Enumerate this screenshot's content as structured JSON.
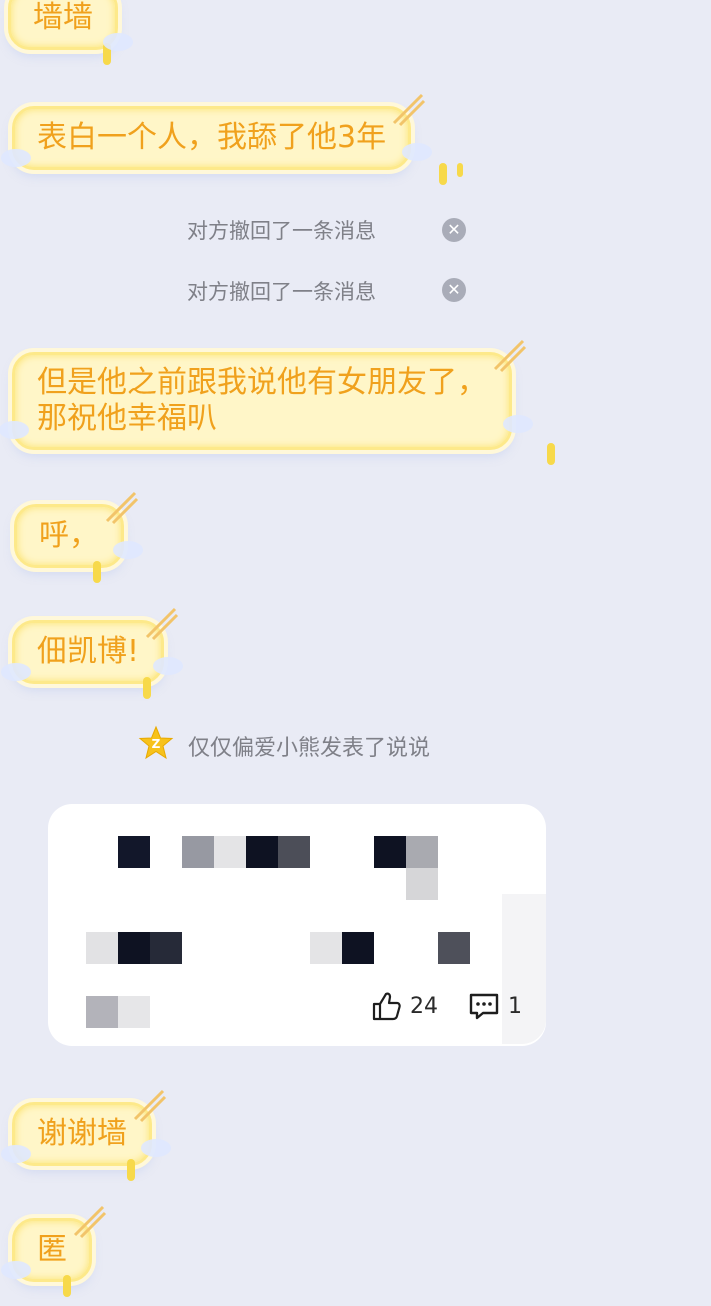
{
  "messages": [
    {
      "text": "墙墙"
    },
    {
      "text": "表白一个人，我舔了他3年"
    },
    {
      "text": "但是他之前跟我说他有女朋友了，",
      "line2": "那祝他幸福叭"
    },
    {
      "text": "呼，"
    },
    {
      "text": "佃凯博!"
    },
    {
      "text": "谢谢墙"
    },
    {
      "text": "匿"
    }
  ],
  "system": {
    "recall1": "对方撤回了一条消息",
    "recall2": "对方撤回了一条消息",
    "post_notice": "仅仅偏爱小熊发表了说说"
  },
  "card": {
    "likes": "24",
    "comments": "1"
  },
  "icons": {
    "close": "close-icon",
    "qzone": "qzone-star-icon",
    "like": "thumbs-up-icon",
    "comment": "comment-icon"
  },
  "colors": {
    "background": "#e9ebf5",
    "bubble_fill": "#fff6c8",
    "bubble_text": "#f0a11d",
    "system_text": "#7f8088"
  }
}
